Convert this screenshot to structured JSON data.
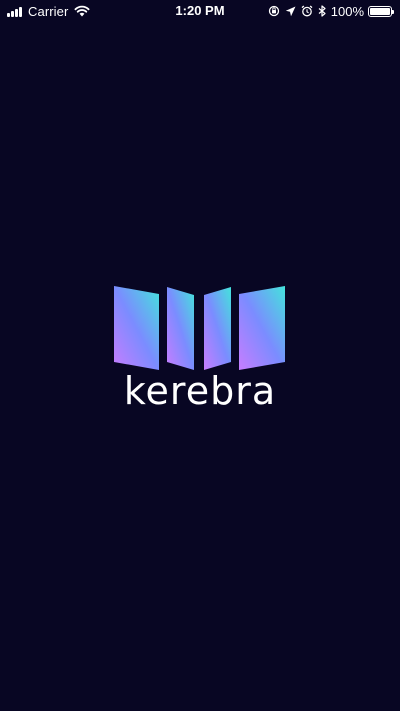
{
  "status_bar": {
    "carrier": "Carrier",
    "time": "1:20 PM",
    "battery_percent": "100%",
    "battery_level": 1.0,
    "signal_bars": 4,
    "icons": [
      "signal-icon",
      "wifi-icon",
      "orientation-lock-icon",
      "location-arrow-icon",
      "alarm-icon",
      "bluetooth-icon",
      "battery-icon"
    ]
  },
  "splash": {
    "app_name": "kerebra",
    "logo_icon": "book-panels-logo",
    "colors": {
      "background": "#080623",
      "gradient_start": "#c77dff",
      "gradient_mid": "#7b8cff",
      "gradient_end": "#44e3dc",
      "text": "#ffffff"
    }
  }
}
